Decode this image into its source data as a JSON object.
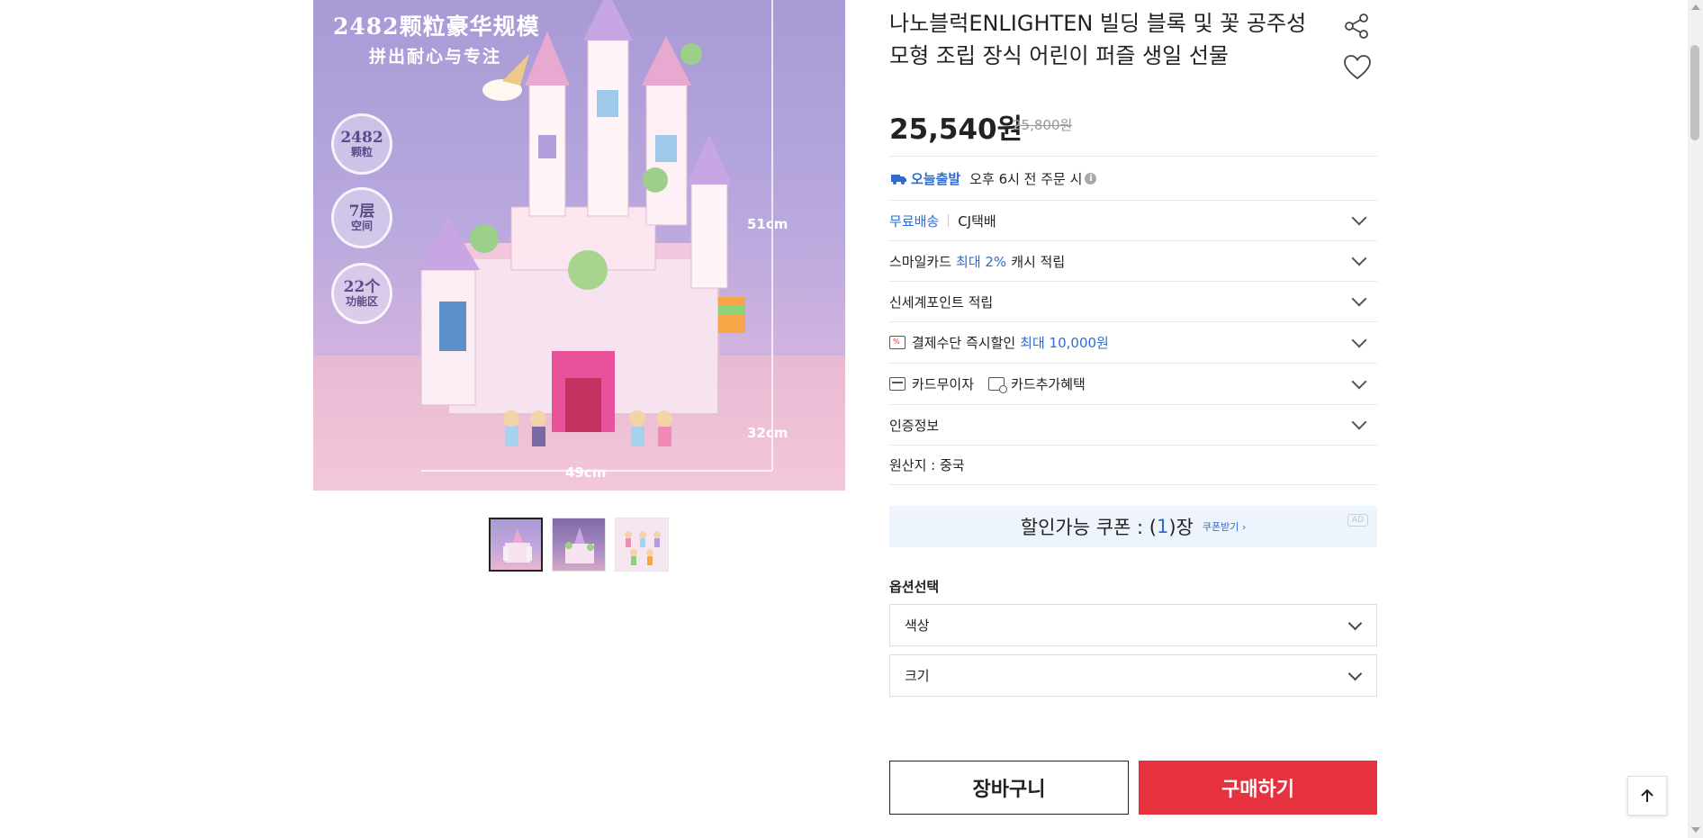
{
  "product_image": {
    "headline": "2482颗粒豪华规模",
    "subheadline": "拼出耐心与专注",
    "badges": [
      {
        "main": "2482",
        "sub": "颗粒"
      },
      {
        "main": "7层",
        "sub": "空间"
      },
      {
        "main": "22个",
        "sub": "功能区"
      }
    ],
    "dimensions": {
      "height": "51cm",
      "depth": "32cm",
      "width": "49cm"
    }
  },
  "thumbnails": [
    "thumbnail-1",
    "thumbnail-2",
    "thumbnail-3"
  ],
  "product": {
    "title": "나노블럭ENLIGHTEN 빌딩 블록 및 꽃 공주성 모형 조립 장식 어린이 퍼즐 생일 선물",
    "price": "25,540원",
    "original_price": "25,800원"
  },
  "shipping": {
    "today_label": "오늘출발",
    "today_text": "오후 6시 전 주문 시",
    "free_label": "무료배송",
    "carrier": "CJ택배"
  },
  "benefits": {
    "smilecard_prefix": "스마일카드",
    "smilecard_highlight": "최대 2%",
    "smilecard_suffix": "캐시 적립",
    "shinsegae": "신세계포인트 적립",
    "payment_prefix": "결제수단 즉시할인",
    "payment_highlight": "최대 10,000원",
    "card_installment": "카드무이자",
    "card_extra": "카드추가혜택",
    "certification": "인증정보",
    "origin": "원산지 : 중국"
  },
  "coupon": {
    "prefix": "할인가능 쿠폰 : (",
    "count": "1",
    "suffix": ")장",
    "get_label": "쿠폰받기 ›",
    "ad_label": "AD"
  },
  "options": {
    "title": "옵션선택",
    "color_label": "색상",
    "size_label": "크기"
  },
  "actions": {
    "cart": "장바구니",
    "buy": "구매하기"
  },
  "colors": {
    "accent_blue": "#2e6cd1",
    "buy_red": "#e5323e"
  }
}
